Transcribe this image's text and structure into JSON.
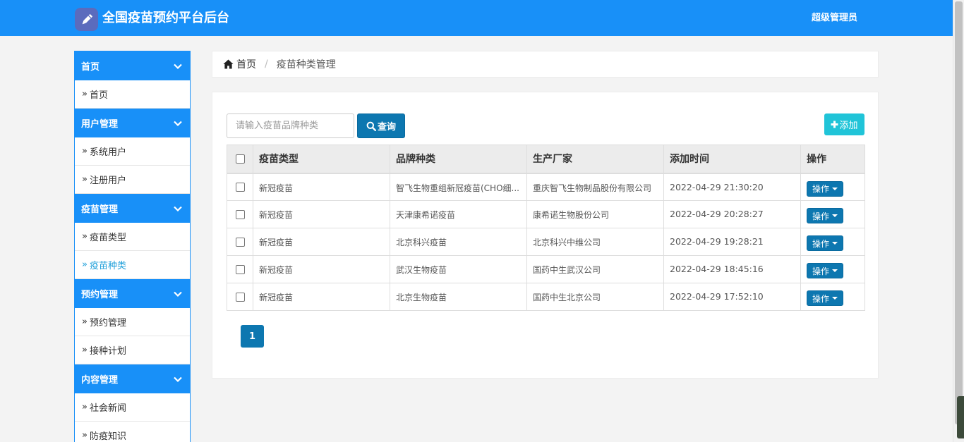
{
  "header": {
    "title": "全国疫苗预约平台后台",
    "user": "超级管理员",
    "logo_icon": "pencil-icon",
    "bg_color": "#1890f8"
  },
  "sidebar": {
    "groups": [
      {
        "title": "首页",
        "items": [
          "首页"
        ]
      },
      {
        "title": "用户管理",
        "items": [
          "系统用户",
          "注册用户"
        ]
      },
      {
        "title": "疫苗管理",
        "items": [
          "疫苗类型",
          "疫苗种类"
        ]
      },
      {
        "title": "预约管理",
        "items": [
          "预约管理",
          "接种计划"
        ]
      },
      {
        "title": "内容管理",
        "items": [
          "社会新闻",
          "防疫知识"
        ]
      }
    ],
    "active_item": "疫苗种类",
    "item_prefix": "»"
  },
  "breadcrumb": {
    "home": "首页",
    "current": "疫苗种类管理"
  },
  "search": {
    "placeholder": "请输入疫苗品牌种类",
    "button": "查询"
  },
  "toolbar": {
    "add_label": "添加"
  },
  "table": {
    "headers": [
      "疫苗类型",
      "品牌种类",
      "生产厂家",
      "添加时间",
      "操作"
    ],
    "rows": [
      {
        "type": "新冠疫苗",
        "brand": "智飞生物重组新冠疫苗(CHO细...",
        "maker": "重庆智飞生物制品股份有限公司",
        "time": "2022-04-29 21:30:20",
        "action": "操作"
      },
      {
        "type": "新冠疫苗",
        "brand": "天津康希诺疫苗",
        "maker": "康希诺生物股份公司",
        "time": "2022-04-29 20:28:27",
        "action": "操作"
      },
      {
        "type": "新冠疫苗",
        "brand": "北京科兴疫苗",
        "maker": "北京科兴中维公司",
        "time": "2022-04-29 19:28:21",
        "action": "操作"
      },
      {
        "type": "新冠疫苗",
        "brand": "武汉生物疫苗",
        "maker": "国药中生武汉公司",
        "time": "2022-04-29 18:45:16",
        "action": "操作"
      },
      {
        "type": "新冠疫苗",
        "brand": "北京生物疫苗",
        "maker": "国药中生北京公司",
        "time": "2022-04-29 17:52:10",
        "action": "操作"
      }
    ]
  },
  "pagination": {
    "current": "1"
  }
}
